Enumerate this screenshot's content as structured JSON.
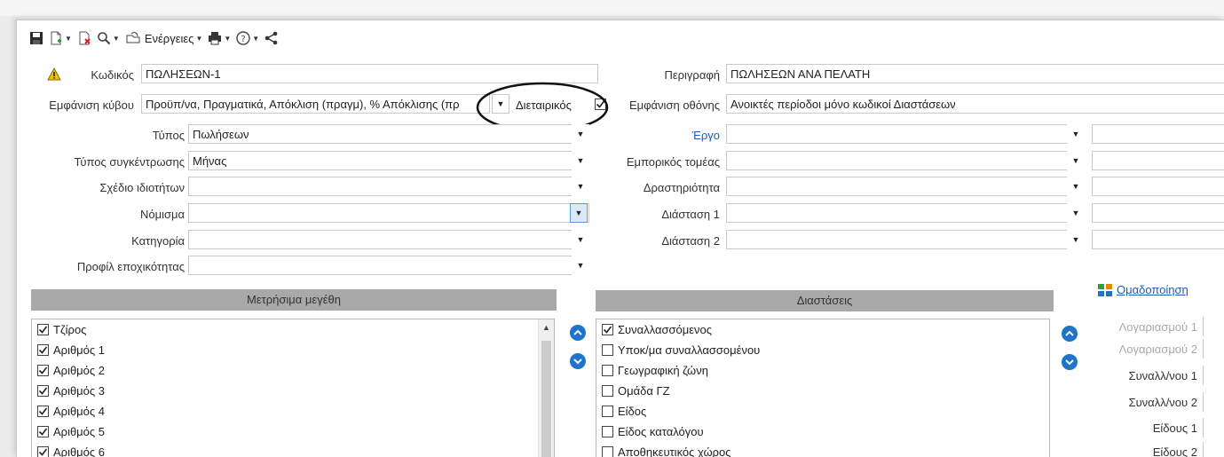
{
  "toolbar": {
    "actions_label": "Ενέργειες"
  },
  "form": {
    "code_label": "Κωδικός",
    "code_value": "ΠΩΛΗΣΕΩΝ-1",
    "cube_label": "Εμφάνιση κύβου",
    "cube_value": "Προϋπ/να, Πραγματικά, Απόκλιση (πραγμ), % Απόκλισης (πρ",
    "dietairikos_label": "Διεταιρικός",
    "dietairikos_checked": true,
    "type_label": "Τύπος",
    "type_value": "Πωλήσεων",
    "agg_label": "Τύπος συγκέντρωσης",
    "agg_value": "Μήνας",
    "props_label": "Σχέδιο ιδιοτήτων",
    "props_value": "",
    "currency_label": "Νόμισμα",
    "currency_value": "",
    "category_label": "Κατηγορία",
    "category_value": "",
    "season_label": "Προφίλ εποχικότητας",
    "season_value": "",
    "desc_label": "Περιγραφή",
    "desc_value": "ΠΩΛΗΣΕΩΝ ΑΝΑ ΠΕΛΑΤΗ",
    "screen_label": "Εμφάνιση οθόνης",
    "screen_value": "Ανοικτές περίοδοι μόνο κωδικοί Διαστάσεων",
    "project_label": "Έργο",
    "project_value": "",
    "sector_label": "Εμπορικός τομέας",
    "sector_value": "",
    "activity_label": "Δραστηριότητα",
    "activity_value": "",
    "dim1_label": "Διάσταση 1",
    "dim1_value": "",
    "dim2_label": "Διάσταση 2",
    "dim2_value": ""
  },
  "measures": {
    "header": "Μετρήσιμα μεγέθη",
    "items": [
      {
        "label": "Τζίρος",
        "checked": true
      },
      {
        "label": "Αριθμός 1",
        "checked": true
      },
      {
        "label": "Αριθμός 2",
        "checked": true
      },
      {
        "label": "Αριθμός 3",
        "checked": true
      },
      {
        "label": "Αριθμός 4",
        "checked": true
      },
      {
        "label": "Αριθμός 5",
        "checked": true
      },
      {
        "label": "Αριθμός 6",
        "checked": true
      }
    ]
  },
  "dimensions": {
    "header": "Διαστάσεις",
    "items": [
      {
        "label": "Συναλλασσόμενος",
        "checked": true
      },
      {
        "label": "Υποκ/μα συναλλασσομένου",
        "checked": false
      },
      {
        "label": "Γεωγραφική ζώνη",
        "checked": false
      },
      {
        "label": "Ομάδα ΓΖ",
        "checked": false
      },
      {
        "label": "Είδος",
        "checked": false
      },
      {
        "label": "Είδος καταλόγου",
        "checked": false
      },
      {
        "label": "Αποθηκευτικός χώρος",
        "checked": false
      }
    ]
  },
  "grouping": {
    "link_label": "Ομαδοποίηση",
    "items": [
      {
        "label": "Λογαριασμού 1",
        "enabled": false
      },
      {
        "label": "Λογαριασμού 2",
        "enabled": false
      },
      {
        "label": "Συναλλ/νου 1",
        "enabled": true
      },
      {
        "label": "Συναλλ/νου 2",
        "enabled": true
      },
      {
        "label": "Είδους 1",
        "enabled": true
      },
      {
        "label": "Είδους 2",
        "enabled": true
      }
    ]
  },
  "colors": {
    "accent": "#1e74c8",
    "link": "#1a5fb4",
    "panel_header": "#a9a9a9",
    "warning": "#f2c200"
  }
}
